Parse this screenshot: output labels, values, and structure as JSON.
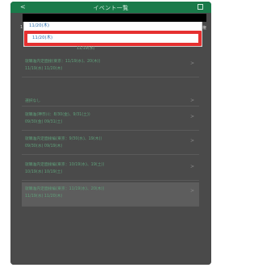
{
  "header": {
    "back": "<",
    "title": "イベント一覧"
  },
  "top_edge": {
    "left": "1",
    "right": "権"
  },
  "top_line": "11/19(水)",
  "dropdown": {
    "items": [
      {
        "label": "11/20(木)"
      },
      {
        "label": "11/20(木)"
      }
    ]
  },
  "list": [
    {
      "line1": "就職准内定面接(東京：11/19(水)、20(木))",
      "line2": "11/19(水) 11/20(木)"
    },
    {
      "line1": "選択なし",
      "line2": ""
    },
    {
      "line1": "就職准(神奈川：8/30(金)、9/31(土))",
      "line2": "09/30(金) 09/31(土)"
    },
    {
      "line1": "就職准内定面接編(東京：9/30(水)、19(木))",
      "line2": "09/30(水) 09/19(木)"
    },
    {
      "line1": "就職准内定面接編(東京：10/19(水)、19(土))",
      "line2": "10/19(水) 10/19(土)"
    },
    {
      "line1": "就職准内定面接編(東京：11/19(水)、20(木))",
      "line2": "11/19(水) 11/20(木)"
    }
  ],
  "colors": {
    "header": "#1a7a4a",
    "highlight": "#e53030",
    "link": "#2a6fb0"
  }
}
